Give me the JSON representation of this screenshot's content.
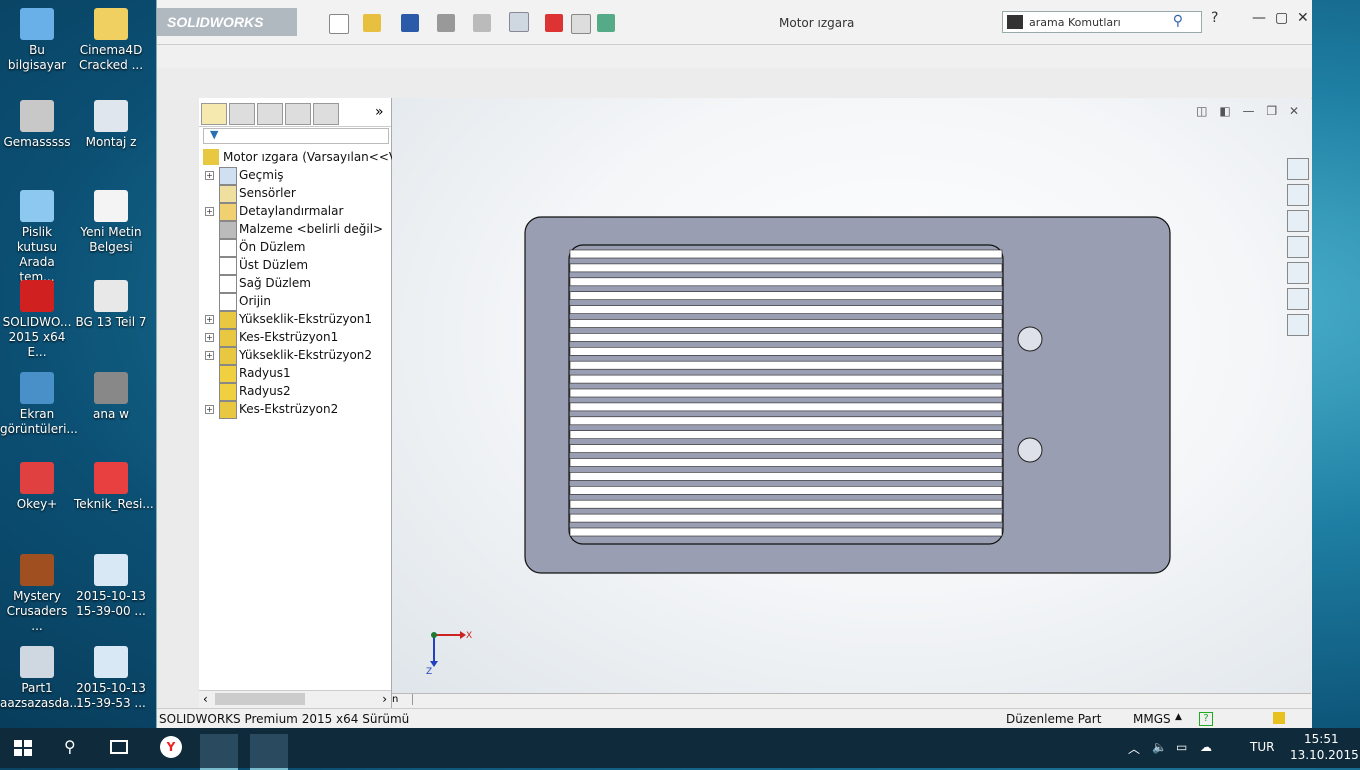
{
  "desktop": {
    "icons": [
      {
        "label": "Bu bilgisayar"
      },
      {
        "label": "Cinema4D Cracked ..."
      },
      {
        "label": "Gemasssss"
      },
      {
        "label": "Montaj z"
      },
      {
        "label": "Pislik kutusu Arada tem..."
      },
      {
        "label": "Yeni Metin Belgesi"
      },
      {
        "label": "SOLIDWO... 2015 x64 E..."
      },
      {
        "label": "BG 13 Teil 7"
      },
      {
        "label": "Ekran görüntüleri..."
      },
      {
        "label": "ana w"
      },
      {
        "label": "Okey+"
      },
      {
        "label": "Teknik_Resi..."
      },
      {
        "label": "Mystery Crusaders ..."
      },
      {
        "label": "2015-10-13 15-39-00 ..."
      },
      {
        "label": "Part1 aazsazasda..."
      },
      {
        "label": "2015-10-13 15-39-53 ..."
      }
    ]
  },
  "window": {
    "logo": "SOLIDWORKS",
    "title": "Motor ızgara",
    "search_placeholder": "arama Komutları"
  },
  "tree": {
    "root": "Motor ızgara  (Varsayılan<<Vars",
    "items": [
      {
        "label": "Geçmiş"
      },
      {
        "label": "Sensörler"
      },
      {
        "label": "Detaylandırmalar"
      },
      {
        "label": "Malzeme <belirli değil>"
      },
      {
        "label": "Ön Düzlem"
      },
      {
        "label": "Üst Düzlem"
      },
      {
        "label": "Sağ Düzlem"
      },
      {
        "label": "Orijin"
      },
      {
        "label": "Yükseklik-Ekstrüzyon1"
      },
      {
        "label": "Kes-Ekstrüzyon1"
      },
      {
        "label": "Yükseklik-Ekstrüzyon2"
      },
      {
        "label": "Radyus1"
      },
      {
        "label": "Radyus2"
      },
      {
        "label": "Kes-Ekstrüzyon2"
      }
    ]
  },
  "status": {
    "product": "SOLIDWORKS Premium 2015 x64 Sürümü",
    "mode": "Düzenleme Part",
    "units": "MMGS"
  },
  "triad": {
    "x": "X",
    "z": "Z"
  },
  "taskbar": {
    "time": "15:51",
    "date": "13.10.2015",
    "lang": "TUR"
  },
  "colors": {
    "part_fill": "#9a9eb2",
    "slot_fill": "#ffffff",
    "accent": "#2b6fb3"
  }
}
